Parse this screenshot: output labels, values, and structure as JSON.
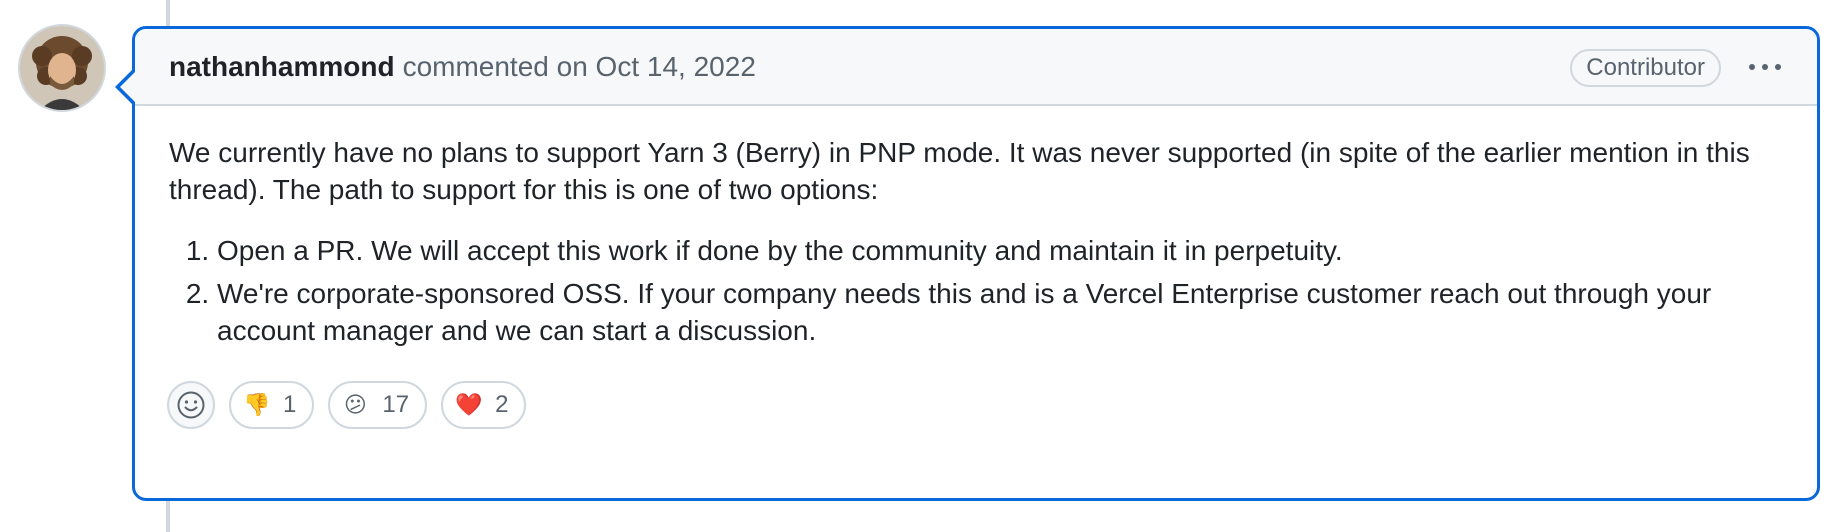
{
  "comment": {
    "author": "nathanhammond",
    "meta": "commented on Oct 14, 2022",
    "badge": "Contributor",
    "body": {
      "paragraph": "We currently have no plans to support Yarn 3 (Berry) in PNP mode. It was never supported (in spite of the earlier mention in this thread). The path to support for this is one of two options:",
      "list": [
        "Open a PR. We will accept this work if done by the community and maintain it in perpetuity.",
        "We're corporate-sponsored OSS. If your company needs this and is a Vercel Enterprise customer reach out through your account manager and we can start a discussion."
      ]
    },
    "reactions": [
      {
        "icon": "thumbs-down-icon",
        "emoji": "👎",
        "count": "1"
      },
      {
        "icon": "confused-face-icon",
        "emoji": "😕",
        "count": "17"
      },
      {
        "icon": "heart-icon",
        "emoji": "❤️",
        "count": "2"
      }
    ]
  },
  "colors": {
    "accent": "#0969da",
    "border": "#d0d7de",
    "header_bg": "#f6f8fa",
    "muted_text": "#59636e"
  }
}
